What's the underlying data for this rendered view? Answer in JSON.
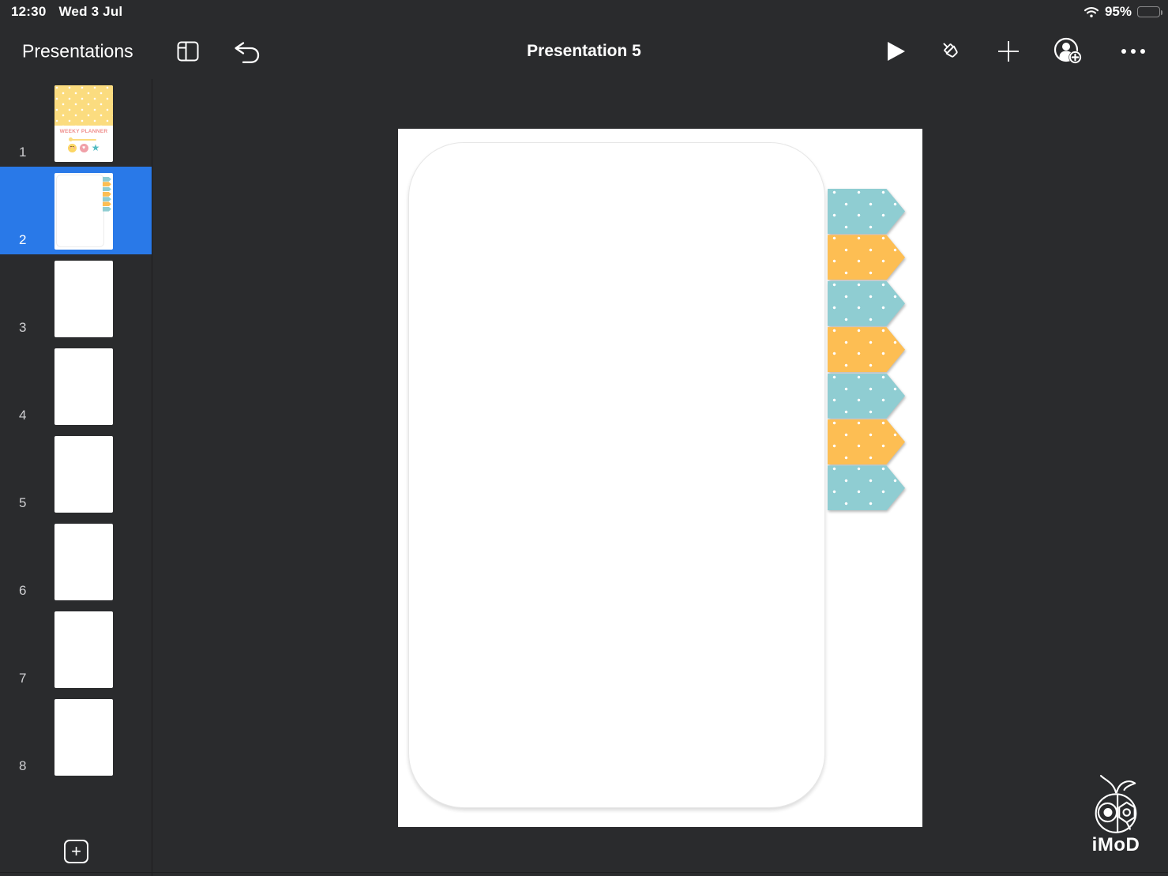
{
  "status_bar": {
    "time": "12:30",
    "date": "Wed 3 Jul",
    "battery_percent": "95%"
  },
  "toolbar": {
    "back_label": "Presentations",
    "title": "Presentation 5",
    "icon_names": [
      "view-options-icon",
      "undo-icon",
      "play-icon",
      "format-brush-icon",
      "add-icon",
      "collaborate-icon",
      "more-icon"
    ]
  },
  "sidebar": {
    "selected_slide": "2",
    "slides": [
      {
        "number": "1",
        "kind": "cover",
        "selected": false
      },
      {
        "number": "2",
        "kind": "tabs",
        "selected": true
      },
      {
        "number": "3",
        "kind": "blank",
        "selected": false
      },
      {
        "number": "4",
        "kind": "blank",
        "selected": false
      },
      {
        "number": "5",
        "kind": "blank",
        "selected": false
      },
      {
        "number": "6",
        "kind": "blank",
        "selected": false
      },
      {
        "number": "7",
        "kind": "blank",
        "selected": false
      },
      {
        "number": "8",
        "kind": "blank",
        "selected": false
      }
    ],
    "cover": {
      "title": "WEEKY PLANNER"
    },
    "add_slide_glyph": "+"
  },
  "canvas": {
    "tabs": [
      {
        "color": "#8fcdd2"
      },
      {
        "color": "#fdbe53"
      },
      {
        "color": "#8fcdd2"
      },
      {
        "color": "#fdbe53"
      },
      {
        "color": "#8fcdd2"
      },
      {
        "color": "#fdbe53"
      },
      {
        "color": "#8fcdd2"
      }
    ]
  },
  "icons": {
    "heart": "♥",
    "star": "★"
  },
  "colors": {
    "selection_blue": "#2979e8",
    "teal": "#8fcdd2",
    "yellow": "#fdbe53",
    "background": "#2a2b2d"
  },
  "watermark": {
    "label": "iMoD"
  }
}
